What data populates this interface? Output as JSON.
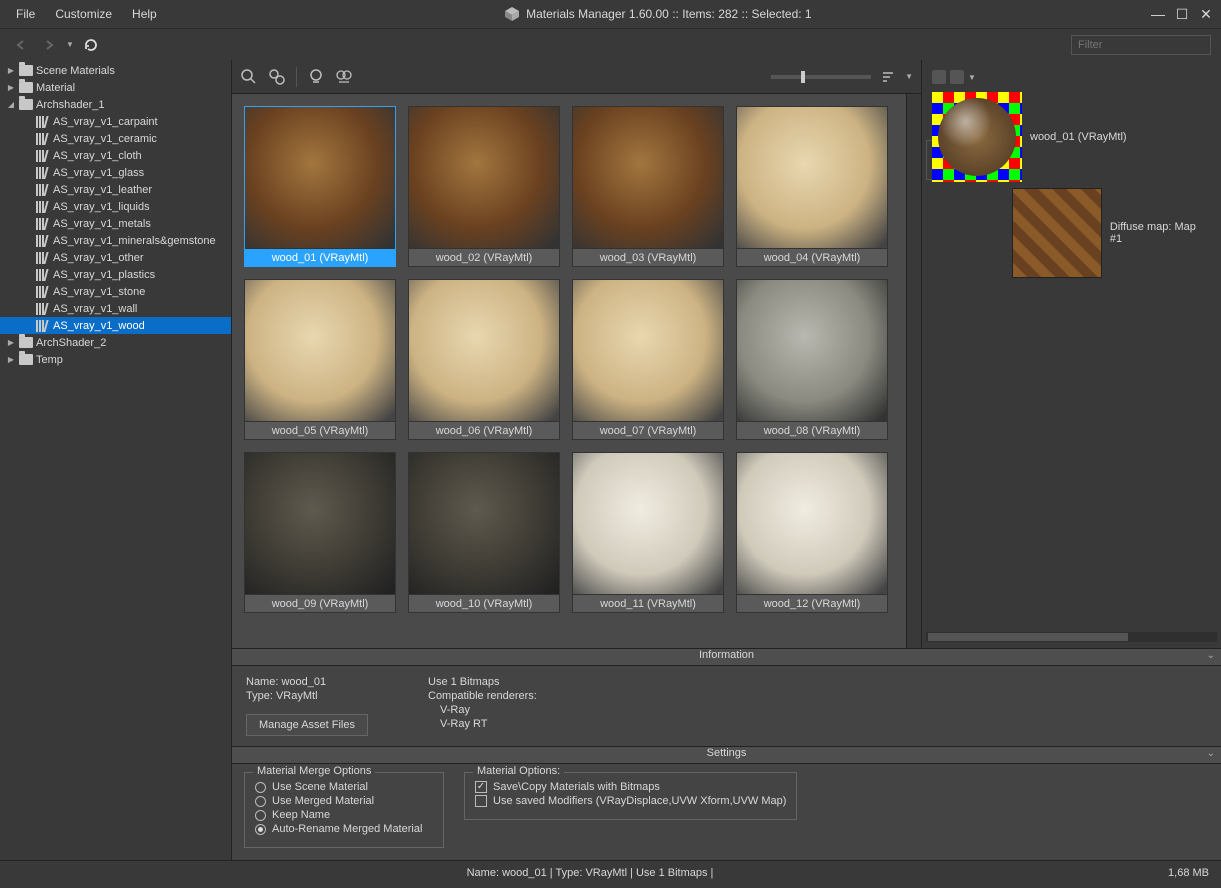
{
  "menu": {
    "file": "File",
    "customize": "Customize",
    "help": "Help"
  },
  "title": "Materials Manager 1.60.00  :: Items: 282  :: Selected: 1",
  "filter_placeholder": "Filter",
  "tree": {
    "scene": "Scene Materials",
    "material": "Material",
    "arch1": "Archshader_1",
    "items": [
      "AS_vray_v1_carpaint",
      "AS_vray_v1_ceramic",
      "AS_vray_v1_cloth",
      "AS_vray_v1_glass",
      "AS_vray_v1_leather",
      "AS_vray_v1_liquids",
      "AS_vray_v1_metals",
      "AS_vray_v1_minerals&gemstone",
      "AS_vray_v1_other",
      "AS_vray_v1_plastics",
      "AS_vray_v1_stone",
      "AS_vray_v1_wall",
      "AS_vray_v1_wood"
    ],
    "arch2": "ArchShader_2",
    "temp": "Temp"
  },
  "thumbs": [
    {
      "label": "wood_01 (VRayMtl)",
      "sel": true,
      "v": "brown"
    },
    {
      "label": "wood_02 (VRayMtl)",
      "v": "brown"
    },
    {
      "label": "wood_03 (VRayMtl)",
      "v": "brown"
    },
    {
      "label": "wood_04 (VRayMtl)",
      "v": "light"
    },
    {
      "label": "wood_05 (VRayMtl)",
      "v": "light"
    },
    {
      "label": "wood_06 (VRayMtl)",
      "v": "light"
    },
    {
      "label": "wood_07 (VRayMtl)",
      "v": "light"
    },
    {
      "label": "wood_08 (VRayMtl)",
      "v": "grey"
    },
    {
      "label": "wood_09 (VRayMtl)",
      "v": "dark"
    },
    {
      "label": "wood_10 (VRayMtl)",
      "v": "dark"
    },
    {
      "label": "wood_11 (VRayMtl)",
      "v": "white"
    },
    {
      "label": "wood_12 (VRayMtl)",
      "v": "white"
    }
  ],
  "inspector": {
    "mat_name": "wood_01 (VRayMtl)",
    "diffuse": "Diffuse map: Map #1"
  },
  "panels": {
    "info": "Information",
    "settings": "Settings"
  },
  "info": {
    "name_l": "Name: wood_01",
    "type_l": "Type: VRayMtl",
    "use_l": "Use 1 Bitmaps",
    "compat_l": "Compatible renderers:",
    "r1": "V-Ray",
    "r2": "V-Ray RT",
    "btn": "Manage Asset Files"
  },
  "settings": {
    "merge_lg": "Material  Merge Options",
    "r1": "Use Scene Material",
    "r2": "Use Merged Material",
    "r3": "Keep Name",
    "r4": "Auto-Rename Merged Material",
    "opts_lg": "Material Options:",
    "c1": "Save\\Copy Materials with Bitmaps",
    "c2": "Use saved Modifiers (VRayDisplace,UVW Xform,UVW Map)"
  },
  "status": {
    "center": "Name: wood_01 | Type: VRayMtl | Use 1 Bitmaps  |",
    "right": "1,68 MB"
  }
}
